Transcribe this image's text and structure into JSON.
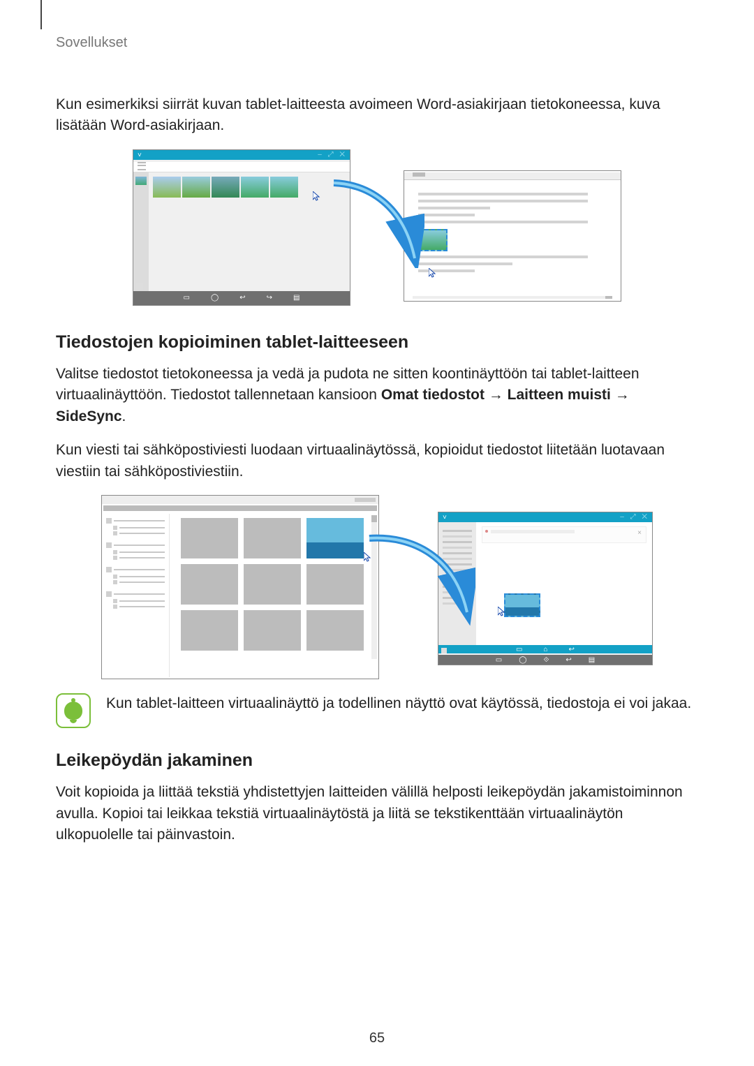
{
  "header": {
    "section": "Sovellukset"
  },
  "intro": "Kun esimerkiksi siirrät kuvan tablet-laitteesta avoimeen Word-asiakirjaan tietokoneessa, kuva lisätään Word-asiakirjaan.",
  "section1": {
    "heading": "Tiedostojen kopioiminen tablet-laitteeseen",
    "p1_pre": "Valitse tiedostot tietokoneessa ja vedä ja pudota ne sitten koontinäyttöön tai tablet-laitteen virtuaalinäyttöön. Tiedostot tallennetaan kansioon ",
    "p1_b1": "Omat tiedostot",
    "p1_arrow1": " → ",
    "p1_b2": "Laitteen muisti",
    "p1_arrow2": " → ",
    "p1_b3": "SideSync",
    "p1_end": ".",
    "p2": "Kun viesti tai sähköpostiviesti luodaan virtuaalinäytössä, kopioidut tiedostot liitetään luotavaan viestiin tai sähköpostiviestiin."
  },
  "note": {
    "text": "Kun tablet-laitteen virtuaalinäyttö ja todellinen näyttö ovat käytössä, tiedostoja ei voi jakaa."
  },
  "section2": {
    "heading": "Leikepöydän jakaminen",
    "p1": "Voit kopioida ja liittää tekstiä yhdistettyjen laitteiden välillä helposti leikepöydän jakamistoiminnon avulla. Kopioi tai leikkaa tekstiä virtuaalinäytöstä ja liitä se tekstikenttään virtuaalinäytön ulkopuolelle tai päinvastoin."
  },
  "page_number": "65"
}
